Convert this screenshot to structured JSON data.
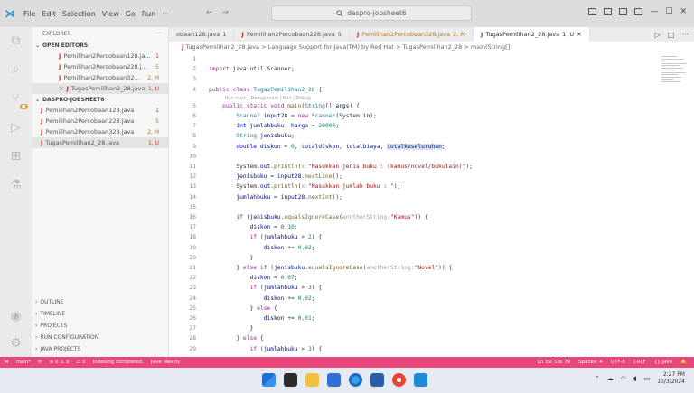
{
  "titlebar": {
    "menu": [
      "File",
      "Edit",
      "Selection",
      "View",
      "Go",
      "Run",
      "···"
    ],
    "search": "daspro-jobsheet6",
    "icons": [
      "vscode-icon",
      "search-icon",
      "layout-icon",
      "minimize-icon",
      "maximize-icon",
      "close-icon"
    ]
  },
  "sidebar": {
    "explorer_label": "EXPLORER",
    "explorer_more": "···",
    "open_editors_label": "OPEN EDITORS",
    "open_editors": [
      {
        "name": "Pemilihan2Percobaan128.ja...",
        "status": "1"
      },
      {
        "name": "Pemilihan2Percobaan228.j...",
        "status": "5"
      },
      {
        "name": "Pemilihan2Percobaan32...",
        "status": "2, M"
      },
      {
        "name": "TugasPemilihan2_28.java",
        "status": "1, U"
      }
    ],
    "project_label": "DASPRO-JOBSHEET6",
    "project_files": [
      {
        "name": "Pemilihan2Percobaan128.java",
        "status": "1"
      },
      {
        "name": "Pemilihan2Percobaan228.java",
        "status": "5"
      },
      {
        "name": "Pemilihan2Percobaan328.java",
        "status": "2, M"
      },
      {
        "name": "TugasPemilihan2_28.java",
        "status": "1, U"
      }
    ],
    "bottom_sections": [
      "OUTLINE",
      "TIMELINE",
      "PROJECTS",
      "RUN CONFIGURATION",
      "JAVA PROJECTS"
    ]
  },
  "tabs": [
    {
      "label": "obaan128.java",
      "status": "1",
      "active": false
    },
    {
      "label": "Pemilihan2Percobaan228.java",
      "status": "5",
      "active": false
    },
    {
      "label": "Pemilihan2Percobaan328.java",
      "status": "2, M",
      "active": false
    },
    {
      "label": "TugasPemilihan2_28.java",
      "status": "1, U",
      "active": true
    }
  ],
  "breadcrumb": "TugasPemilihan2_28.java > Language Support for Java(TM) by Red Hat > TugasPemilihan2_28 > main(String[])",
  "codelens": "Run main | Debug main | Run | Debug",
  "code_lines": [
    {
      "n": "1",
      "html": ""
    },
    {
      "n": "2",
      "html": "<span class='kw'>import</span> java.util.Scanner;"
    },
    {
      "n": "3",
      "html": ""
    },
    {
      "n": "4",
      "html": "<span class='kw'>public class</span> <span class='cls'>TugasPemilihan2_28</span> {"
    },
    {
      "n": "5",
      "html": "    <span class='kw'>public static void</span> <span class='fn'>main</span>(<span class='cls'>String</span>[] <span class='var'>args</span>) {"
    },
    {
      "n": "6",
      "html": "        <span class='cls'>Scanner</span> <span class='var'>input28</span> = <span class='kw'>new</span> <span class='cls'>Scanner</span>(System.<span class='var'>in</span>);"
    },
    {
      "n": "7",
      "html": "        <span class='kw2'>int</span> <span class='var'>jumlahbuku</span>, <span class='var'>harga</span> = <span class='num'>20000</span>;"
    },
    {
      "n": "8",
      "html": "        <span class='cls'>String</span> <span class='var'>jenisbuku</span>;"
    },
    {
      "n": "9",
      "html": "        <span class='kw2'>double</span> <span class='var'>diskon</span> = <span class='num'>0</span>, <span class='var'>totaldiskon</span>, <span class='var'>totalbiaya</span>, <span class='hl'><span class='var'>totalkeseluruhan</span></span>;"
    },
    {
      "n": "10",
      "html": ""
    },
    {
      "n": "11",
      "html": "        System.<span class='var'>out</span>.<span class='fn'>println</span>(<span class='hint'>x:</span><span class='str'>\"Masukkan jenis buku : (kamus/novel/bukulain)\"</span>);"
    },
    {
      "n": "12",
      "html": "        <span class='var'>jenisbuku</span> = <span class='var'>input28</span>.<span class='fn'>nextLine</span>();"
    },
    {
      "n": "13",
      "html": "        System.<span class='var'>out</span>.<span class='fn'>println</span>(<span class='hint'>x:</span><span class='str'>\"Masukkan jumlah buku : \"</span>);"
    },
    {
      "n": "14",
      "html": "        <span class='var'>jumlahbuku</span> = <span class='var'>input28</span>.<span class='fn'>nextInt</span>();"
    },
    {
      "n": "15",
      "html": ""
    },
    {
      "n": "16",
      "html": "        <span class='kw'>if</span> (<span class='var'>jenisbuku</span>.<span class='fn'>equalsIgnoreCase</span>(<span class='hint'>anotherString:</span><span class='str'>\"Kamus\"</span>)) {"
    },
    {
      "n": "17",
      "html": "            <span class='var'>diskon</span> = <span class='num'>0.10</span>;"
    },
    {
      "n": "18",
      "html": "            <span class='kw'>if</span> (<span class='var'>jumlahbuku</span> &gt; <span class='num'>2</span>) {"
    },
    {
      "n": "19",
      "html": "                <span class='var'>diskon</span> += <span class='num'>0.02</span>;"
    },
    {
      "n": "20",
      "html": "            }"
    },
    {
      "n": "21",
      "html": "        } <span class='kw'>else if</span> (<span class='var'>jenisbuku</span>.<span class='fn'>equalsIgnoreCase</span>(<span class='hint'>anotherString:</span><span class='str'>\"Novel\"</span>)) {"
    },
    {
      "n": "22",
      "html": "            <span class='var'>diskon</span> = <span class='num'>0.07</span>;"
    },
    {
      "n": "23",
      "html": "            <span class='kw'>if</span> (<span class='var'>jumlahbuku</span> &gt; <span class='num'>3</span>) {"
    },
    {
      "n": "24",
      "html": "                <span class='var'>diskon</span> += <span class='num'>0.02</span>;"
    },
    {
      "n": "25",
      "html": "            } <span class='kw'>else</span> {"
    },
    {
      "n": "26",
      "html": "                <span class='var'>diskon</span> += <span class='num'>0.01</span>;"
    },
    {
      "n": "27",
      "html": "            }"
    },
    {
      "n": "28",
      "html": "        } <span class='kw'>else</span> {"
    },
    {
      "n": "29",
      "html": "            <span class='kw'>if</span> (<span class='var'>jumlahbuku</span> &gt; <span class='num'>3</span>) {"
    }
  ],
  "statusbar": {
    "left": [
      "main*",
      "⟳",
      "⊗ 0 ⚠ 9",
      "⚠ 0",
      "Indexing completed.",
      "Java: Ready"
    ],
    "right": [
      "Ln 39, Col 79",
      "Spaces: 4",
      "UTF-8",
      "CRLF",
      "{} Java"
    ]
  },
  "taskbar": {
    "time": "2:27 PM",
    "date": "10/3/2024"
  },
  "colors": {
    "status_bar": "#e9467a",
    "java_icon": "#c0392b"
  }
}
